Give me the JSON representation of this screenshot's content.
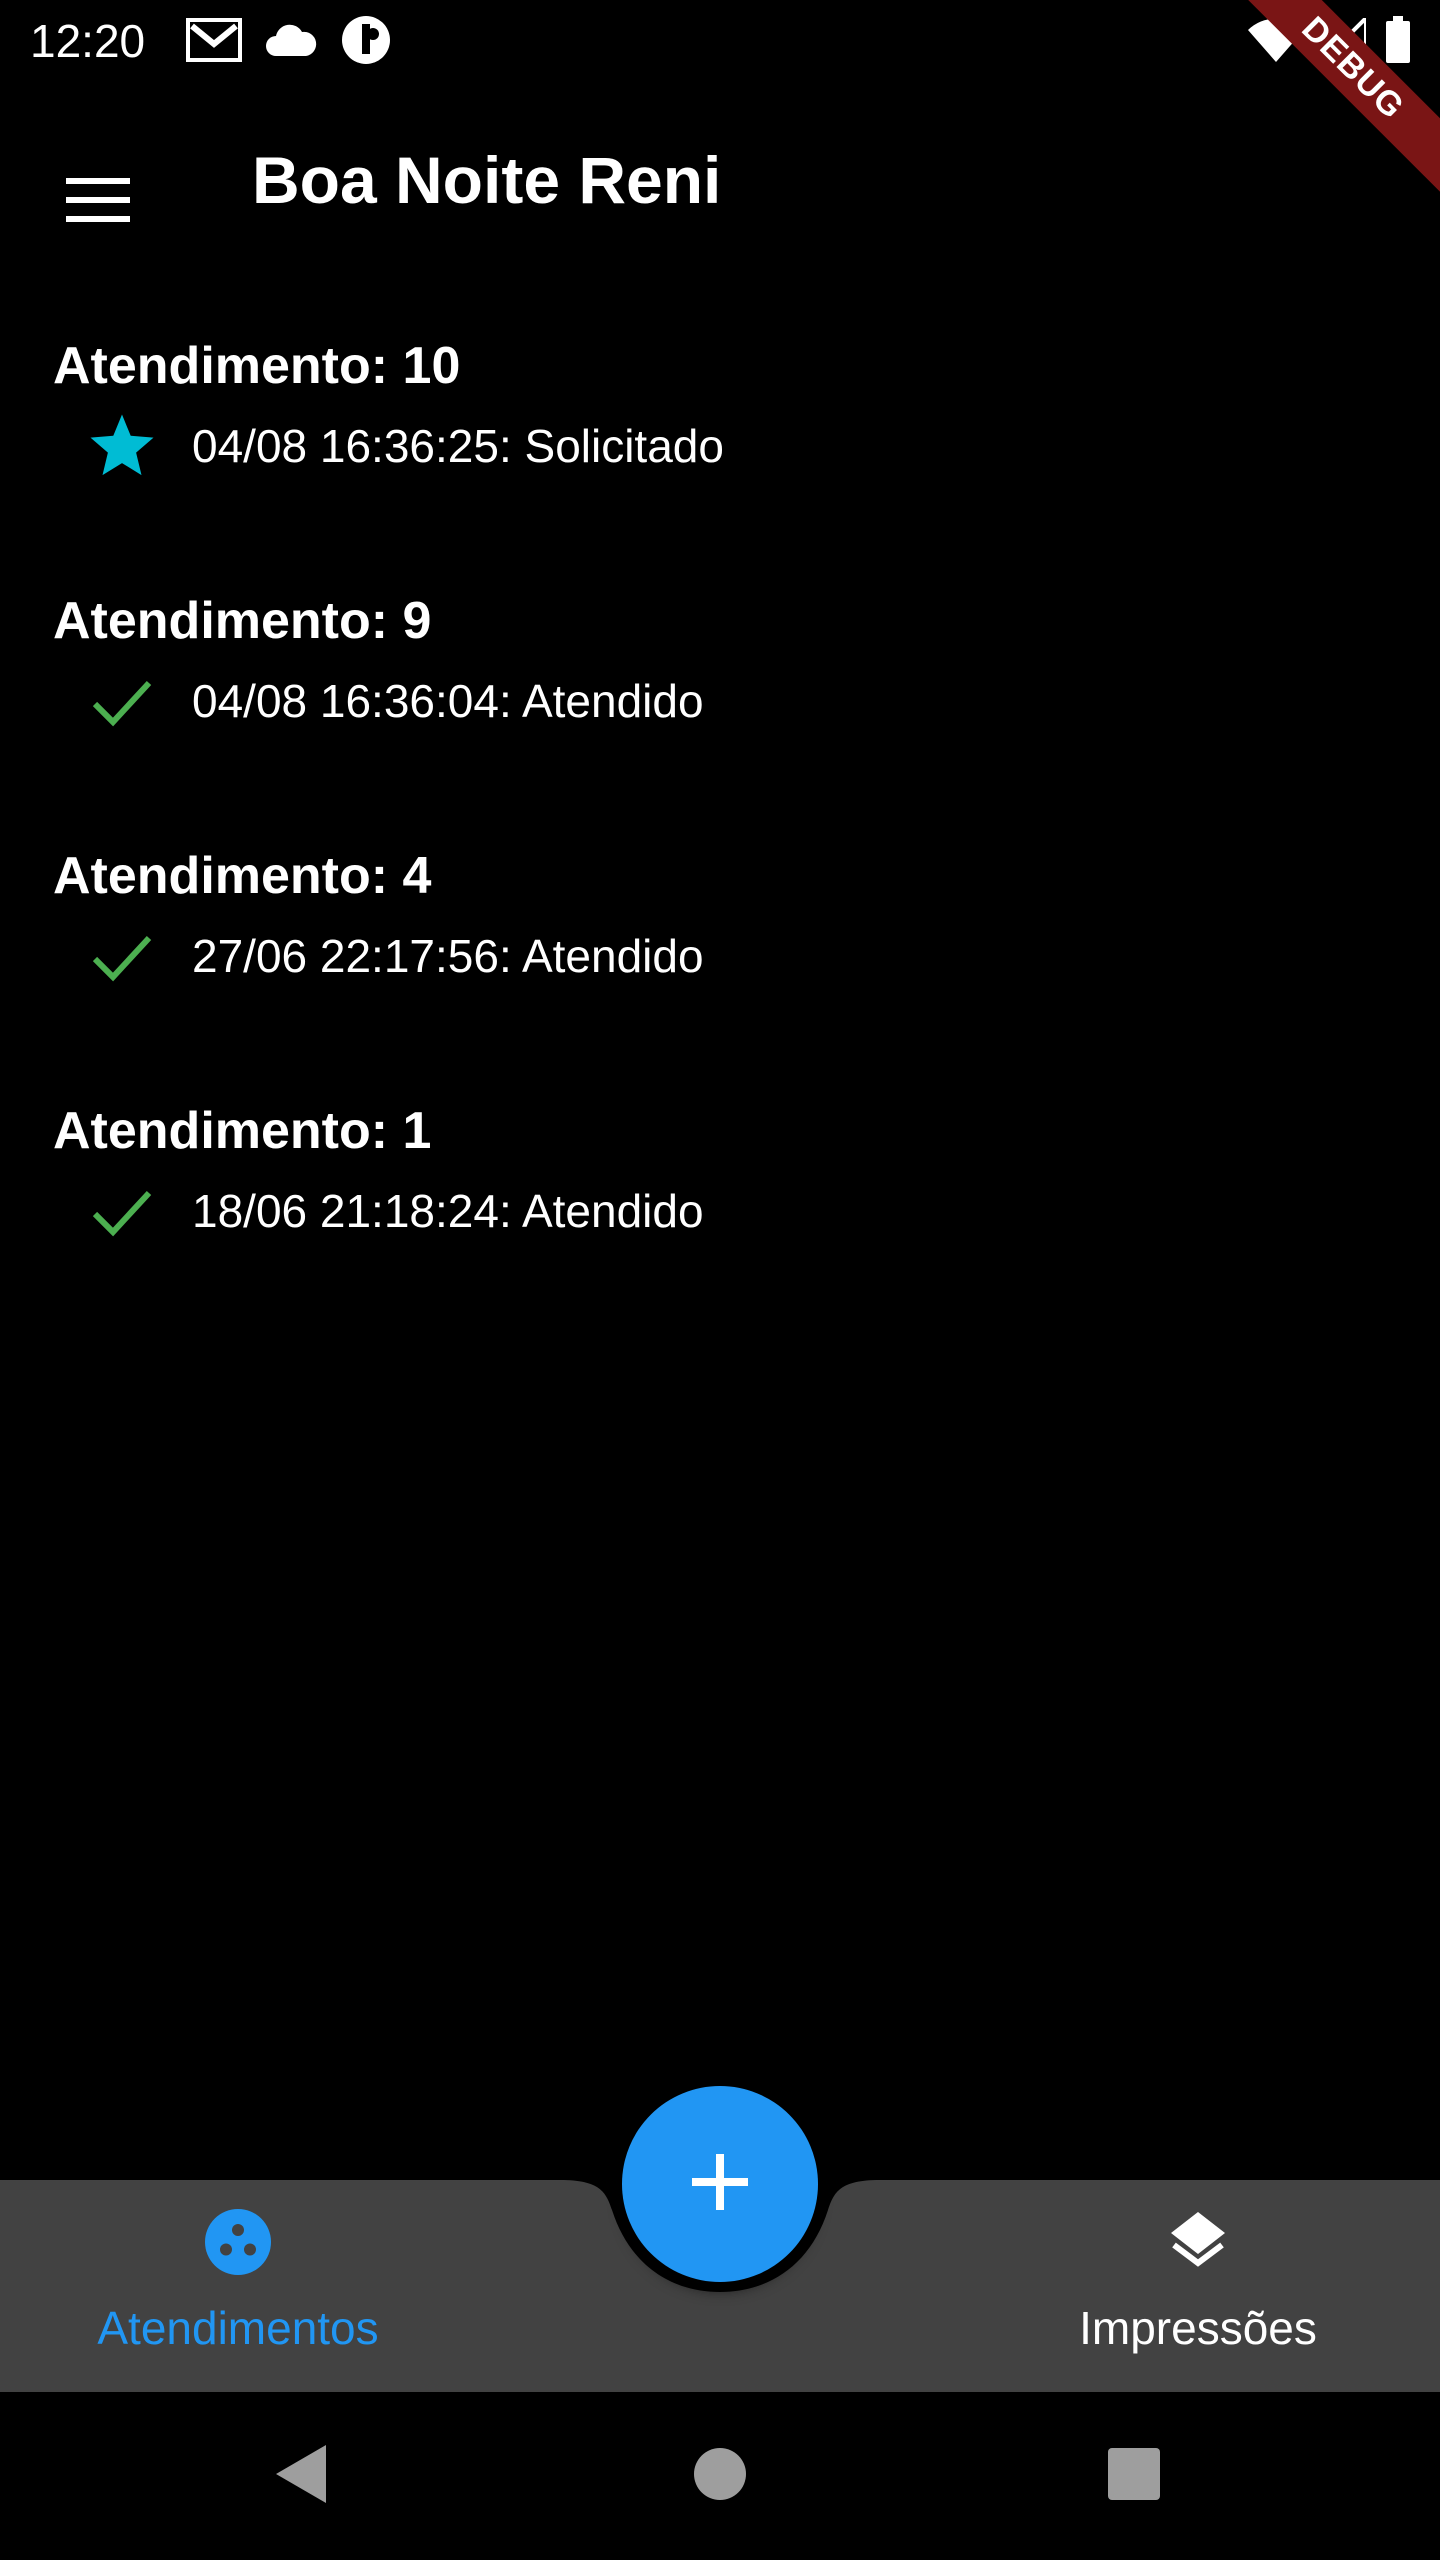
{
  "status_bar": {
    "time": "12:20",
    "left_icons": [
      "gmail-icon",
      "cloud-icon",
      "clock-app-icon"
    ],
    "right_icons": [
      "wifi-icon",
      "signal-icon",
      "battery-icon"
    ],
    "debug_label": "DEBUG"
  },
  "app_bar": {
    "menu_icon": "menu-icon",
    "title": "Boa Noite Reni"
  },
  "atendimentos": [
    {
      "title": "Atendimento: 10",
      "status_icon": "star-icon",
      "status_color": "#00bcd4",
      "detail": "04/08 16:36:25: Solicitado"
    },
    {
      "title": "Atendimento: 9",
      "status_icon": "check-icon",
      "status_color": "#4caf50",
      "detail": "04/08 16:36:04: Atendido"
    },
    {
      "title": "Atendimento: 4",
      "status_icon": "check-icon",
      "status_color": "#4caf50",
      "detail": "27/06 22:17:56: Atendido"
    },
    {
      "title": "Atendimento: 1",
      "status_icon": "check-icon",
      "status_color": "#4caf50",
      "detail": "18/06 21:18:24: Atendido"
    }
  ],
  "bottom_nav": {
    "items": [
      {
        "label": "Atendimentos",
        "icon": "bubble-dots-icon",
        "active": true
      },
      {
        "label": "Impressões",
        "icon": "layers-icon",
        "active": false
      }
    ],
    "fab_icon": "plus-icon"
  },
  "colors": {
    "accent": "#2196f3",
    "bottom_bar": "#424242",
    "inactive_nav": "#ffffff",
    "debug_banner": "#7a1515"
  },
  "system_nav": [
    "back-icon",
    "home-icon",
    "recents-icon"
  ]
}
